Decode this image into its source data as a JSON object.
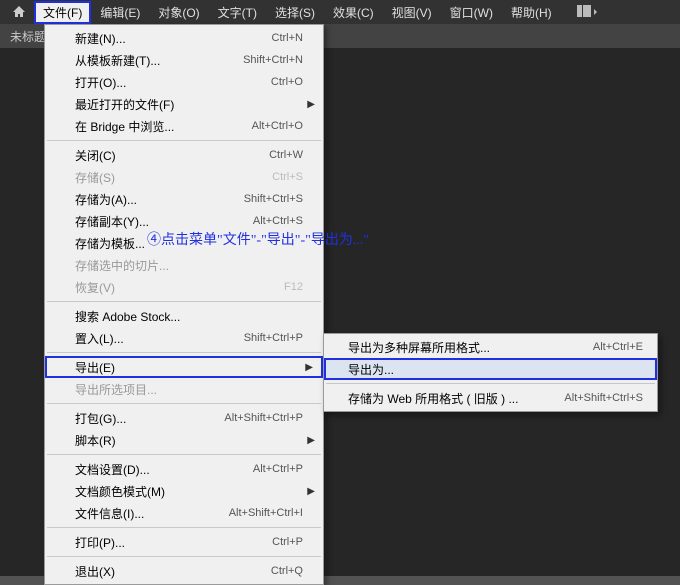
{
  "menubar": {
    "items": [
      "文件(F)",
      "编辑(E)",
      "对象(O)",
      "文字(T)",
      "选择(S)",
      "效果(C)",
      "视图(V)",
      "窗口(W)",
      "帮助(H)"
    ]
  },
  "tabbar": {
    "title": "未标题"
  },
  "annotation": "④点击菜单\"文件\"-\"导出\"-\"导出为...\"",
  "dropdown": {
    "groups": [
      [
        {
          "label": "新建(N)...",
          "shortcut": "Ctrl+N",
          "disabled": false,
          "sub": false
        },
        {
          "label": "从模板新建(T)...",
          "shortcut": "Shift+Ctrl+N",
          "disabled": false,
          "sub": false
        },
        {
          "label": "打开(O)...",
          "shortcut": "Ctrl+O",
          "disabled": false,
          "sub": false
        },
        {
          "label": "最近打开的文件(F)",
          "shortcut": "",
          "disabled": false,
          "sub": true
        },
        {
          "label": "在 Bridge 中浏览...",
          "shortcut": "Alt+Ctrl+O",
          "disabled": false,
          "sub": false
        }
      ],
      [
        {
          "label": "关闭(C)",
          "shortcut": "Ctrl+W",
          "disabled": false,
          "sub": false
        },
        {
          "label": "存储(S)",
          "shortcut": "Ctrl+S",
          "disabled": true,
          "sub": false
        },
        {
          "label": "存储为(A)...",
          "shortcut": "Shift+Ctrl+S",
          "disabled": false,
          "sub": false
        },
        {
          "label": "存储副本(Y)...",
          "shortcut": "Alt+Ctrl+S",
          "disabled": false,
          "sub": false
        },
        {
          "label": "存储为模板...",
          "shortcut": "",
          "disabled": false,
          "sub": false
        },
        {
          "label": "存储选中的切片...",
          "shortcut": "",
          "disabled": true,
          "sub": false
        },
        {
          "label": "恢复(V)",
          "shortcut": "F12",
          "disabled": true,
          "sub": false
        }
      ],
      [
        {
          "label": "搜索 Adobe Stock...",
          "shortcut": "",
          "disabled": false,
          "sub": false
        },
        {
          "label": "置入(L)...",
          "shortcut": "Shift+Ctrl+P",
          "disabled": false,
          "sub": false
        }
      ],
      [
        {
          "label": "导出(E)",
          "shortcut": "",
          "disabled": false,
          "sub": true,
          "hl": true
        },
        {
          "label": "导出所选项目...",
          "shortcut": "",
          "disabled": true,
          "sub": false
        }
      ],
      [
        {
          "label": "打包(G)...",
          "shortcut": "Alt+Shift+Ctrl+P",
          "disabled": false,
          "sub": false
        },
        {
          "label": "脚本(R)",
          "shortcut": "",
          "disabled": false,
          "sub": true
        }
      ],
      [
        {
          "label": "文档设置(D)...",
          "shortcut": "Alt+Ctrl+P",
          "disabled": false,
          "sub": false
        },
        {
          "label": "文档颜色模式(M)",
          "shortcut": "",
          "disabled": false,
          "sub": true
        },
        {
          "label": "文件信息(I)...",
          "shortcut": "Alt+Shift+Ctrl+I",
          "disabled": false,
          "sub": false
        }
      ],
      [
        {
          "label": "打印(P)...",
          "shortcut": "Ctrl+P",
          "disabled": false,
          "sub": false
        }
      ],
      [
        {
          "label": "退出(X)",
          "shortcut": "Ctrl+Q",
          "disabled": false,
          "sub": false
        }
      ]
    ]
  },
  "submenu": {
    "groups": [
      [
        {
          "label": "导出为多种屏幕所用格式...",
          "shortcut": "Alt+Ctrl+E",
          "hl": false
        },
        {
          "label": "导出为...",
          "shortcut": "",
          "hl": true
        }
      ],
      [
        {
          "label": "存储为 Web 所用格式 ( 旧版 ) ...",
          "shortcut": "Alt+Shift+Ctrl+S",
          "hl": false
        }
      ]
    ]
  }
}
